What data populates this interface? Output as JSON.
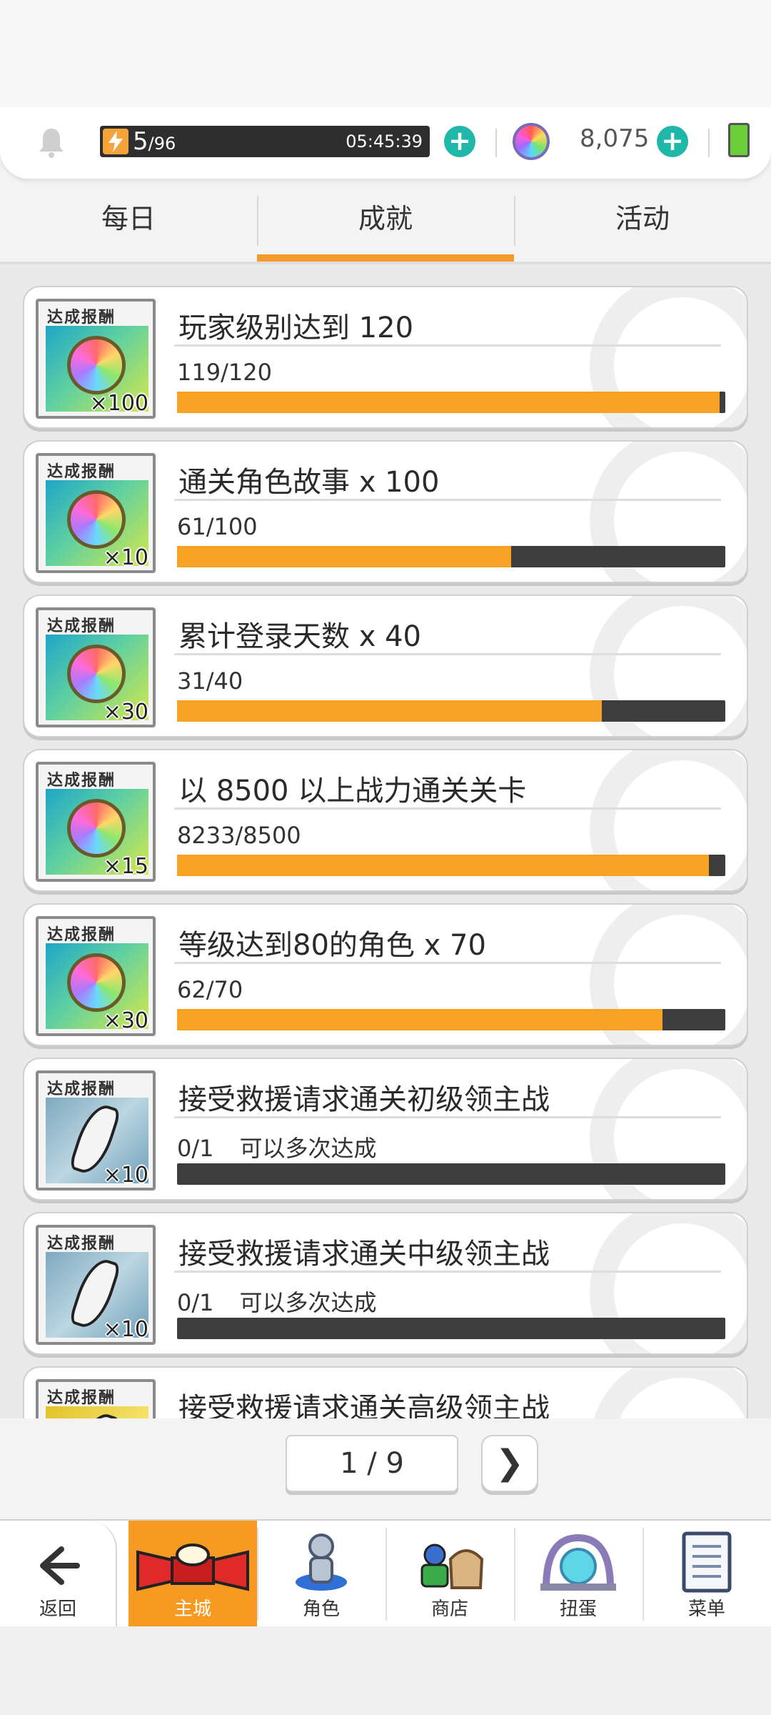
{
  "status": {
    "stamina_current": "5",
    "stamina_max": "/96",
    "stamina_timer": "05:45:39",
    "gems": "8,075"
  },
  "tabs": [
    {
      "label": "每日"
    },
    {
      "label": "成就",
      "active": true
    },
    {
      "label": "活动"
    }
  ],
  "achievements": [
    {
      "reward_label": "达成报酬",
      "reward_type": "rainbow-gem",
      "reward_qty": "×100",
      "title": "玩家级别达到 120",
      "progress_text": "119/120",
      "note": "",
      "progress": 0.99
    },
    {
      "reward_label": "达成报酬",
      "reward_type": "rainbow-gem",
      "reward_qty": "×10",
      "title": "通关角色故事  x 100",
      "progress_text": "61/100",
      "note": "",
      "progress": 0.61
    },
    {
      "reward_label": "达成报酬",
      "reward_type": "rainbow-gem",
      "reward_qty": "×30",
      "title": "累计登录天数  x 40",
      "progress_text": "31/40",
      "note": "",
      "progress": 0.775
    },
    {
      "reward_label": "达成报酬",
      "reward_type": "rainbow-gem",
      "reward_qty": "×15",
      "title": "以 8500 以上战力通关关卡",
      "progress_text": "8233/8500",
      "note": "",
      "progress": 0.97
    },
    {
      "reward_label": "达成报酬",
      "reward_type": "rainbow-gem",
      "reward_qty": "×30",
      "title": "等级达到80的角色  x 70",
      "progress_text": "62/70",
      "note": "",
      "progress": 0.886
    },
    {
      "reward_label": "达成报酬",
      "reward_type": "silver-feather",
      "reward_qty": "×10",
      "title": "接受救援请求通关初级领主战",
      "progress_text": "0/1",
      "note": "可以多次达成",
      "progress": 0
    },
    {
      "reward_label": "达成报酬",
      "reward_type": "silver-feather",
      "reward_qty": "×10",
      "title": "接受救援请求通关中级领主战",
      "progress_text": "0/1",
      "note": "可以多次达成",
      "progress": 0
    },
    {
      "reward_label": "达成报酬",
      "reward_type": "gold-feather",
      "reward_qty": "",
      "title": "接受救援请求通关高级领主战",
      "progress_text": "",
      "note": "",
      "progress": 0
    }
  ],
  "pagination": {
    "text": "1 / 9",
    "next": "❯"
  },
  "nav": [
    {
      "label": "返回",
      "icon": "back-arrow-icon"
    },
    {
      "label": "主城",
      "icon": "castle-icon",
      "active": true
    },
    {
      "label": "角色",
      "icon": "character-icon"
    },
    {
      "label": "商店",
      "icon": "shop-icon"
    },
    {
      "label": "扭蛋",
      "icon": "gacha-icon"
    },
    {
      "label": "菜单",
      "icon": "menu-icon"
    }
  ],
  "colors": {
    "accent": "#f79a22",
    "progress_fill": "#f7a125",
    "progress_track": "#3d3d3d",
    "plus": "#1fb8a8"
  }
}
